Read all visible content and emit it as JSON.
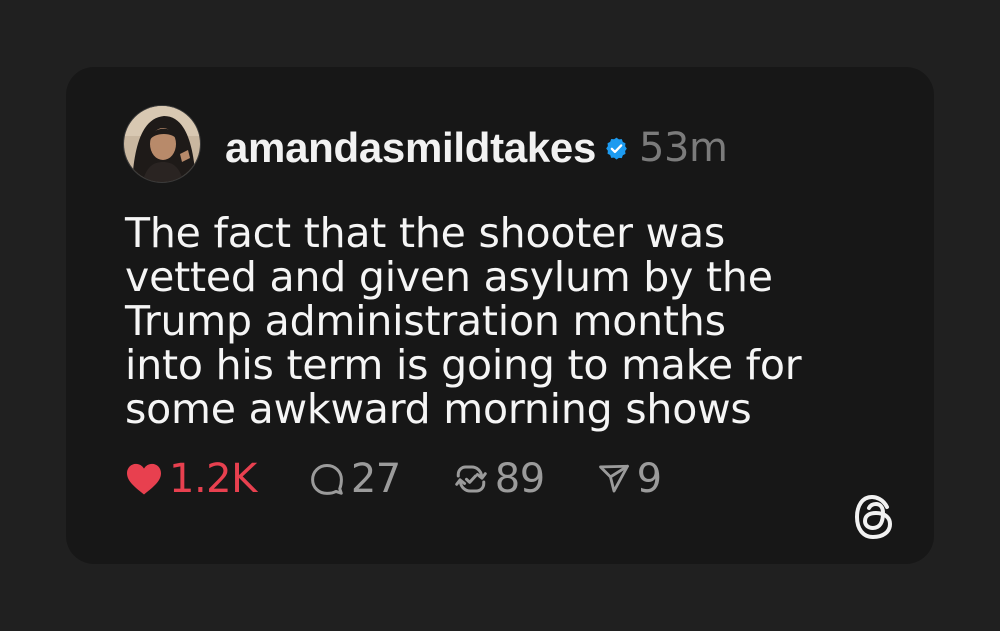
{
  "post": {
    "username": "amandasmildtakes",
    "verified": true,
    "time_ago": "53m",
    "text": "The fact that the shooter was\nvetted and given asylum by the\nTrump administration months\ninto his term is going to make for\nsome awkward morning shows",
    "actions": {
      "likes": "1.2K",
      "liked": true,
      "replies": "27",
      "reposts": "89",
      "shares": "9"
    }
  },
  "colors": {
    "page_background": "#202020",
    "card_background": "#171717",
    "like_red": "#e8404f",
    "verified_blue": "#1d9bf0",
    "muted_gray": "#9b9b9b"
  },
  "icons": {
    "like": "heart-icon",
    "reply": "speech-bubble-icon",
    "repost": "repost-arrows-icon",
    "share": "paper-plane-icon",
    "verified": "verified-badge-icon",
    "brand": "threads-logo-icon"
  }
}
